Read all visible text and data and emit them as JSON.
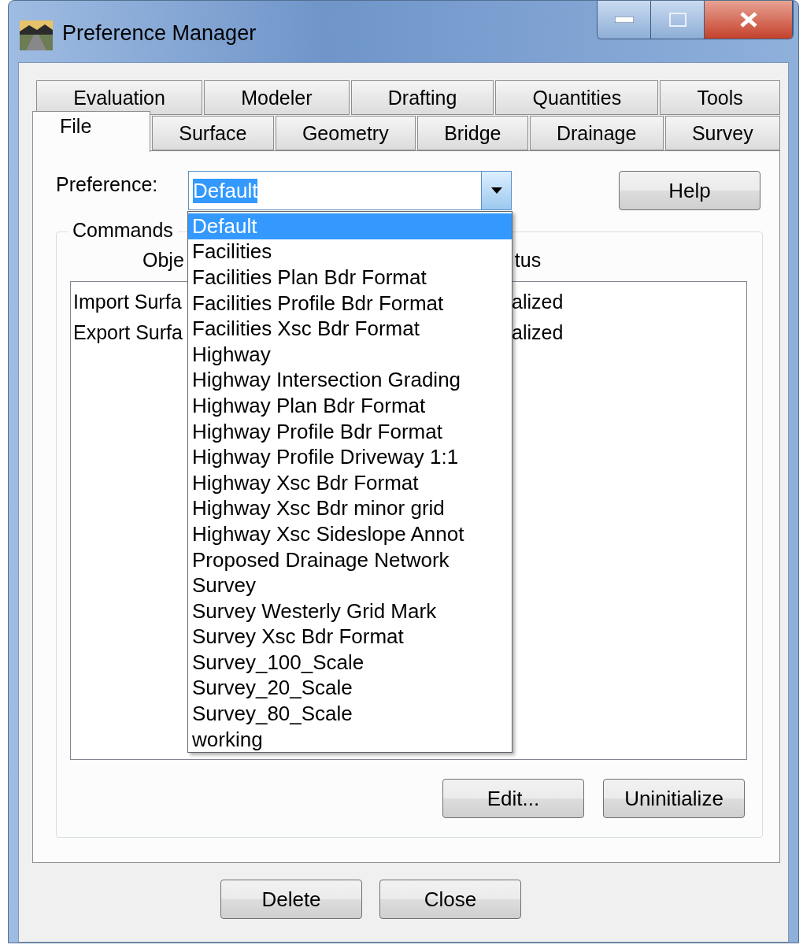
{
  "window": {
    "title": "Preference Manager"
  },
  "tab_rows": [
    [
      {
        "label": "Evaluation",
        "selected": false
      },
      {
        "label": "Modeler",
        "selected": false
      },
      {
        "label": "Drafting",
        "selected": false
      },
      {
        "label": "Quantities",
        "selected": false
      },
      {
        "label": "Tools",
        "selected": false
      }
    ],
    [
      {
        "label": "File",
        "selected": true
      },
      {
        "label": "Surface",
        "selected": false
      },
      {
        "label": "Geometry",
        "selected": false
      },
      {
        "label": "Bridge",
        "selected": false
      },
      {
        "label": "Drainage",
        "selected": false
      },
      {
        "label": "Survey",
        "selected": false
      }
    ]
  ],
  "preference": {
    "label": "Preference:",
    "value": "Default",
    "expanded": true,
    "options": [
      {
        "label": "Default",
        "selected": true
      },
      {
        "label": "Facilities",
        "selected": false
      },
      {
        "label": "Facilities Plan Bdr Format",
        "selected": false
      },
      {
        "label": "Facilities Profile Bdr Format",
        "selected": false
      },
      {
        "label": "Facilities Xsc Bdr Format",
        "selected": false
      },
      {
        "label": "Highway",
        "selected": false
      },
      {
        "label": "Highway Intersection Grading",
        "selected": false
      },
      {
        "label": "Highway Plan Bdr Format",
        "selected": false
      },
      {
        "label": "Highway Profile Bdr Format",
        "selected": false
      },
      {
        "label": "Highway Profile Driveway 1:1",
        "selected": false
      },
      {
        "label": "Highway Xsc Bdr Format",
        "selected": false
      },
      {
        "label": "Highway Xsc Bdr minor grid",
        "selected": false
      },
      {
        "label": "Highway Xsc Sideslope Annot",
        "selected": false
      },
      {
        "label": "Proposed Drainage Network",
        "selected": false
      },
      {
        "label": "Survey",
        "selected": false
      },
      {
        "label": "Survey Westerly Grid Mark",
        "selected": false
      },
      {
        "label": "Survey Xsc Bdr Format",
        "selected": false
      },
      {
        "label": "Survey_100_Scale",
        "selected": false
      },
      {
        "label": "Survey_20_Scale",
        "selected": false
      },
      {
        "label": "Survey_80_Scale",
        "selected": false
      },
      {
        "label": "working",
        "selected": false
      }
    ]
  },
  "help_button": "Help",
  "commands": {
    "title": "Commands",
    "columns": [
      "Obje",
      "tus"
    ],
    "rows": [
      [
        "Import Surfa",
        "alized"
      ],
      [
        "Export Surfa",
        "alized"
      ]
    ],
    "buttons": [
      "Edit...",
      "Uninitialize"
    ]
  },
  "buttons": [
    "Delete",
    "Close"
  ]
}
